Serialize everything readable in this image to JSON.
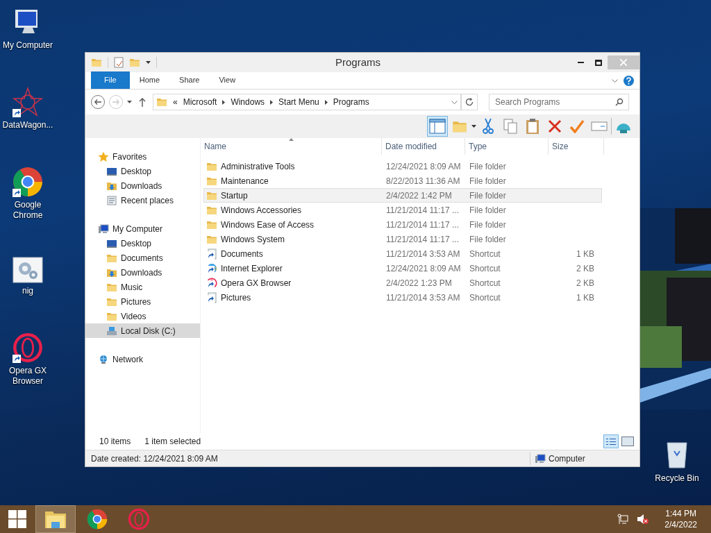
{
  "desktop_icons": [
    {
      "label": "My Computer",
      "kind": "computer"
    },
    {
      "label": "DataWagon...",
      "kind": "star"
    },
    {
      "label": "Google Chrome",
      "kind": "chrome"
    },
    {
      "label": "nig",
      "kind": "gear"
    },
    {
      "label": "Opera GX Browser",
      "kind": "opera"
    }
  ],
  "recycle_bin": {
    "label": "Recycle Bin"
  },
  "window": {
    "title": "Programs",
    "ribbon_tabs": [
      {
        "label": "File",
        "selected": true
      },
      {
        "label": "Home",
        "selected": false
      },
      {
        "label": "Share",
        "selected": false
      },
      {
        "label": "View",
        "selected": false
      }
    ],
    "address": {
      "overflow": "«",
      "crumbs": [
        "Microsoft",
        "Windows",
        "Start Menu",
        "Programs"
      ]
    },
    "search": {
      "placeholder": "Search Programs"
    },
    "nav": [
      {
        "label": "Favorites",
        "kind": "star",
        "selected": false,
        "children": [
          {
            "label": "Desktop",
            "kind": "desktop",
            "selected": false
          },
          {
            "label": "Downloads",
            "kind": "downloads",
            "selected": false
          },
          {
            "label": "Recent places",
            "kind": "recent",
            "selected": false
          }
        ]
      },
      {
        "label": "My Computer",
        "kind": "computer",
        "selected": false,
        "children": [
          {
            "label": "Desktop",
            "kind": "desktop",
            "selected": false
          },
          {
            "label": "Documents",
            "kind": "folder",
            "selected": false
          },
          {
            "label": "Downloads",
            "kind": "downloads",
            "selected": false
          },
          {
            "label": "Music",
            "kind": "folder",
            "selected": false
          },
          {
            "label": "Pictures",
            "kind": "folder",
            "selected": false
          },
          {
            "label": "Videos",
            "kind": "folder",
            "selected": false
          },
          {
            "label": "Local Disk (C:)",
            "kind": "disk",
            "selected": true
          }
        ]
      },
      {
        "label": "Network",
        "kind": "network",
        "selected": false
      }
    ],
    "columns": [
      "Name",
      "Date modified",
      "Type",
      "Size"
    ],
    "rows": [
      {
        "name": "Administrative Tools",
        "date": "12/24/2021 8:09 AM",
        "type": "File folder",
        "kind": "folder",
        "selected": false
      },
      {
        "name": "Maintenance",
        "date": "8/22/2013 11:36 AM",
        "type": "File folder",
        "kind": "folder",
        "selected": false
      },
      {
        "name": "Startup",
        "date": "2/4/2022 1:42 PM",
        "type": "File folder",
        "kind": "folder",
        "selected": true
      },
      {
        "name": "Windows Accessories",
        "date": "11/21/2014 11:17 ...",
        "type": "File folder",
        "kind": "folder",
        "selected": false
      },
      {
        "name": "Windows Ease of Access",
        "date": "11/21/2014 11:17 ...",
        "type": "File folder",
        "kind": "folder",
        "selected": false
      },
      {
        "name": "Windows System",
        "date": "11/21/2014 11:17 ...",
        "type": "File folder",
        "kind": "folder",
        "selected": false
      },
      {
        "name": "Documents",
        "date": "11/21/2014 3:53 AM",
        "type": "Shortcut",
        "size": "1 KB",
        "kind": "shortcut",
        "selected": false
      },
      {
        "name": "Internet Explorer",
        "date": "12/24/2021 8:09 AM",
        "type": "Shortcut",
        "size": "2 KB",
        "kind": "ie",
        "selected": false
      },
      {
        "name": "Opera GX Browser",
        "date": "2/4/2022 1:23 PM",
        "type": "Shortcut",
        "size": "2 KB",
        "kind": "opera",
        "selected": false
      },
      {
        "name": "Pictures",
        "date": "11/21/2014 3:53 AM",
        "type": "Shortcut",
        "size": "1 KB",
        "kind": "shortcut",
        "selected": false
      }
    ],
    "item_count": "10 items",
    "selection_count": "1 item selected",
    "details": "Date created: 12/24/2021 8:09 AM",
    "location": "Computer"
  },
  "taskbar": {
    "apps": [
      {
        "kind": "explorer",
        "selected": true
      },
      {
        "kind": "chrome",
        "selected": false
      },
      {
        "kind": "opera",
        "selected": false
      }
    ],
    "time": "1:44 PM",
    "date": "2/4/2022"
  }
}
